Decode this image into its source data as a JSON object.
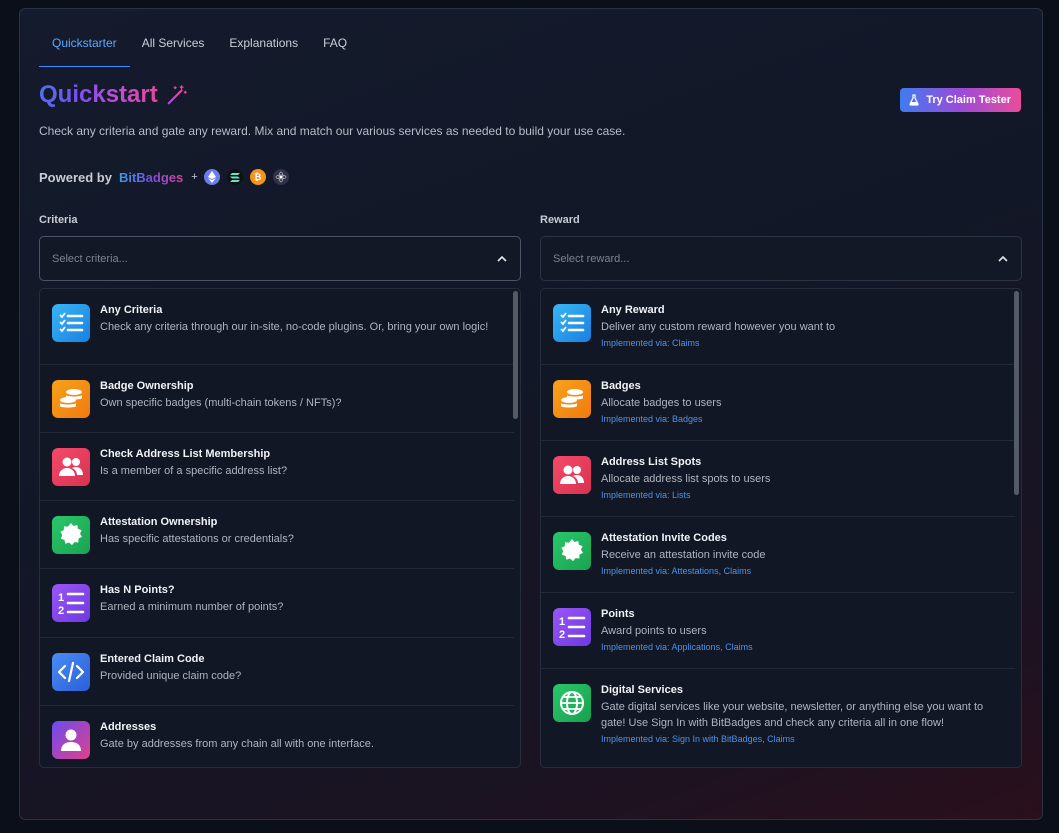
{
  "tabs": [
    "Quickstarter",
    "All Services",
    "Explanations",
    "FAQ"
  ],
  "header": {
    "title": "Quickstart",
    "subtitle": "Check any criteria and gate any reward. Mix and match our various services as needed to build your use case.",
    "try_button": "Try Claim Tester"
  },
  "powered": {
    "label": "Powered by",
    "brand": "BitBadges",
    "plus": "+",
    "chains": [
      "ethereum-icon",
      "solana-icon",
      "bitcoin-icon",
      "cosmos-icon"
    ]
  },
  "criteria": {
    "label": "Criteria",
    "placeholder": "Select criteria...",
    "items": [
      {
        "name": "Any Criteria",
        "desc": "Check any criteria through our in-site, no-code plugins. Or, bring your own logic!",
        "icon": "checklist-icon"
      },
      {
        "name": "Badge Ownership",
        "desc": "Own specific badges (multi-chain tokens / NFTs)?",
        "icon": "coins-icon"
      },
      {
        "name": "Check Address List Membership",
        "desc": "Is a member of a specific address list?",
        "icon": "users-icon"
      },
      {
        "name": "Attestation Ownership",
        "desc": "Has specific attestations or credentials?",
        "icon": "certificate-icon"
      },
      {
        "name": "Has N Points?",
        "desc": "Earned a minimum number of points?",
        "icon": "numbered-list-icon"
      },
      {
        "name": "Entered Claim Code",
        "desc": "Provided unique claim code?",
        "icon": "code-icon"
      },
      {
        "name": "Addresses",
        "desc": "Gate by addresses from any chain all with one interface.",
        "icon": "user-icon"
      }
    ]
  },
  "reward": {
    "label": "Reward",
    "placeholder": "Select reward...",
    "items": [
      {
        "name": "Any Reward",
        "desc": "Deliver any custom reward however you want to",
        "impl": "Implemented via: Claims",
        "icon": "checklist-icon"
      },
      {
        "name": "Badges",
        "desc": "Allocate badges to users",
        "impl": "Implemented via: Badges",
        "icon": "coins-icon"
      },
      {
        "name": "Address List Spots",
        "desc": "Allocate address list spots to users",
        "impl": "Implemented via: Lists",
        "icon": "users-icon"
      },
      {
        "name": "Attestation Invite Codes",
        "desc": "Receive an attestation invite code",
        "impl": "Implemented via: Attestations, Claims",
        "icon": "certificate-icon"
      },
      {
        "name": "Points",
        "desc": "Award points to users",
        "impl": "Implemented via: Applications, Claims",
        "icon": "numbered-list-icon"
      },
      {
        "name": "Digital Services",
        "desc": "Gate digital services like your website, newsletter, or anything else you want to gate! Use Sign In with BitBadges and check any criteria all in one flow!",
        "impl": "Implemented via: Sign In with BitBadges, Claims",
        "icon": "globe-icon"
      }
    ]
  }
}
